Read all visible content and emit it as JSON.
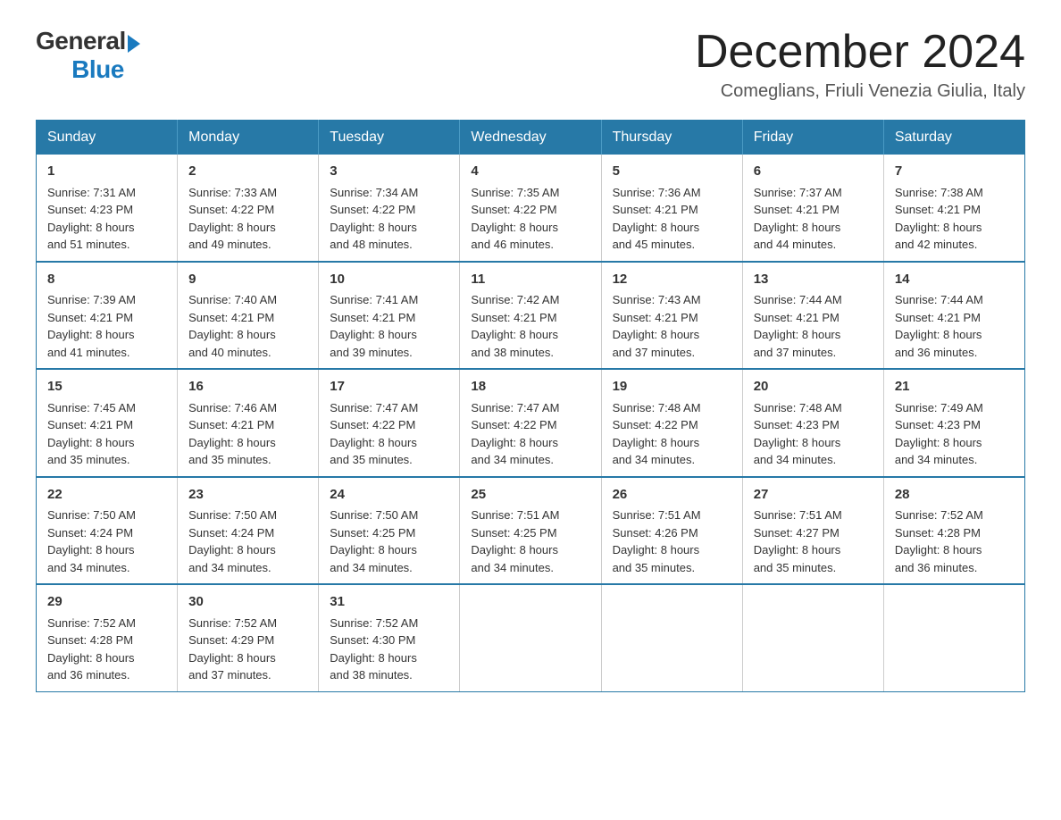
{
  "header": {
    "logo_general": "General",
    "logo_blue": "Blue",
    "month_year": "December 2024",
    "location": "Comeglians, Friuli Venezia Giulia, Italy"
  },
  "days_of_week": [
    "Sunday",
    "Monday",
    "Tuesday",
    "Wednesday",
    "Thursday",
    "Friday",
    "Saturday"
  ],
  "weeks": [
    [
      {
        "day": "1",
        "sunrise": "7:31 AM",
        "sunset": "4:23 PM",
        "daylight": "8 hours and 51 minutes."
      },
      {
        "day": "2",
        "sunrise": "7:33 AM",
        "sunset": "4:22 PM",
        "daylight": "8 hours and 49 minutes."
      },
      {
        "day": "3",
        "sunrise": "7:34 AM",
        "sunset": "4:22 PM",
        "daylight": "8 hours and 48 minutes."
      },
      {
        "day": "4",
        "sunrise": "7:35 AM",
        "sunset": "4:22 PM",
        "daylight": "8 hours and 46 minutes."
      },
      {
        "day": "5",
        "sunrise": "7:36 AM",
        "sunset": "4:21 PM",
        "daylight": "8 hours and 45 minutes."
      },
      {
        "day": "6",
        "sunrise": "7:37 AM",
        "sunset": "4:21 PM",
        "daylight": "8 hours and 44 minutes."
      },
      {
        "day": "7",
        "sunrise": "7:38 AM",
        "sunset": "4:21 PM",
        "daylight": "8 hours and 42 minutes."
      }
    ],
    [
      {
        "day": "8",
        "sunrise": "7:39 AM",
        "sunset": "4:21 PM",
        "daylight": "8 hours and 41 minutes."
      },
      {
        "day": "9",
        "sunrise": "7:40 AM",
        "sunset": "4:21 PM",
        "daylight": "8 hours and 40 minutes."
      },
      {
        "day": "10",
        "sunrise": "7:41 AM",
        "sunset": "4:21 PM",
        "daylight": "8 hours and 39 minutes."
      },
      {
        "day": "11",
        "sunrise": "7:42 AM",
        "sunset": "4:21 PM",
        "daylight": "8 hours and 38 minutes."
      },
      {
        "day": "12",
        "sunrise": "7:43 AM",
        "sunset": "4:21 PM",
        "daylight": "8 hours and 37 minutes."
      },
      {
        "day": "13",
        "sunrise": "7:44 AM",
        "sunset": "4:21 PM",
        "daylight": "8 hours and 37 minutes."
      },
      {
        "day": "14",
        "sunrise": "7:44 AM",
        "sunset": "4:21 PM",
        "daylight": "8 hours and 36 minutes."
      }
    ],
    [
      {
        "day": "15",
        "sunrise": "7:45 AM",
        "sunset": "4:21 PM",
        "daylight": "8 hours and 35 minutes."
      },
      {
        "day": "16",
        "sunrise": "7:46 AM",
        "sunset": "4:21 PM",
        "daylight": "8 hours and 35 minutes."
      },
      {
        "day": "17",
        "sunrise": "7:47 AM",
        "sunset": "4:22 PM",
        "daylight": "8 hours and 35 minutes."
      },
      {
        "day": "18",
        "sunrise": "7:47 AM",
        "sunset": "4:22 PM",
        "daylight": "8 hours and 34 minutes."
      },
      {
        "day": "19",
        "sunrise": "7:48 AM",
        "sunset": "4:22 PM",
        "daylight": "8 hours and 34 minutes."
      },
      {
        "day": "20",
        "sunrise": "7:48 AM",
        "sunset": "4:23 PM",
        "daylight": "8 hours and 34 minutes."
      },
      {
        "day": "21",
        "sunrise": "7:49 AM",
        "sunset": "4:23 PM",
        "daylight": "8 hours and 34 minutes."
      }
    ],
    [
      {
        "day": "22",
        "sunrise": "7:50 AM",
        "sunset": "4:24 PM",
        "daylight": "8 hours and 34 minutes."
      },
      {
        "day": "23",
        "sunrise": "7:50 AM",
        "sunset": "4:24 PM",
        "daylight": "8 hours and 34 minutes."
      },
      {
        "day": "24",
        "sunrise": "7:50 AM",
        "sunset": "4:25 PM",
        "daylight": "8 hours and 34 minutes."
      },
      {
        "day": "25",
        "sunrise": "7:51 AM",
        "sunset": "4:25 PM",
        "daylight": "8 hours and 34 minutes."
      },
      {
        "day": "26",
        "sunrise": "7:51 AM",
        "sunset": "4:26 PM",
        "daylight": "8 hours and 35 minutes."
      },
      {
        "day": "27",
        "sunrise": "7:51 AM",
        "sunset": "4:27 PM",
        "daylight": "8 hours and 35 minutes."
      },
      {
        "day": "28",
        "sunrise": "7:52 AM",
        "sunset": "4:28 PM",
        "daylight": "8 hours and 36 minutes."
      }
    ],
    [
      {
        "day": "29",
        "sunrise": "7:52 AM",
        "sunset": "4:28 PM",
        "daylight": "8 hours and 36 minutes."
      },
      {
        "day": "30",
        "sunrise": "7:52 AM",
        "sunset": "4:29 PM",
        "daylight": "8 hours and 37 minutes."
      },
      {
        "day": "31",
        "sunrise": "7:52 AM",
        "sunset": "4:30 PM",
        "daylight": "8 hours and 38 minutes."
      },
      null,
      null,
      null,
      null
    ]
  ],
  "labels": {
    "sunrise": "Sunrise:",
    "sunset": "Sunset:",
    "daylight": "Daylight:"
  }
}
